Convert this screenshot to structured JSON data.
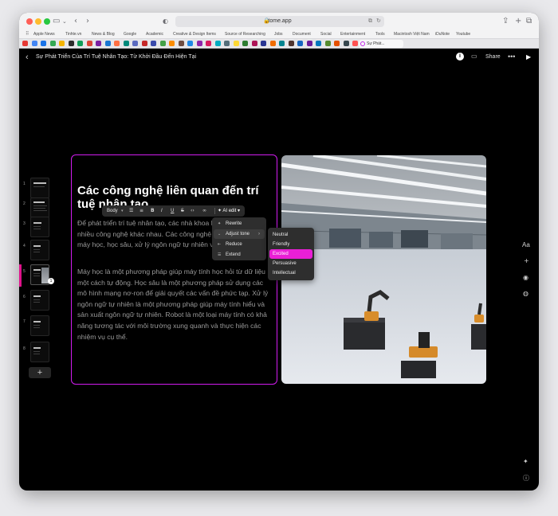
{
  "browser": {
    "url": "tome.app",
    "bookmarks": [
      "Apple News",
      "Tinhte.vn",
      "News & Blog",
      "Google",
      "Academic",
      "Creative & Design Items",
      "Source of Researching",
      "Jobs",
      "Document",
      "Social",
      "Entertainment",
      "Tools",
      "Macintosh Việt Nam",
      "iDuNote",
      "Youtube"
    ],
    "active_tab_title": "Sự Phát..."
  },
  "header": {
    "doc_title": "Sự Phát Triển Của Trí Tuệ Nhân Tạo: Từ Khởi Đầu Đến Hiện Tại",
    "info_label": "i",
    "share_label": "Share"
  },
  "thumbnails": {
    "pages": [
      "1",
      "2",
      "3",
      "4",
      "5",
      "6",
      "7",
      "8"
    ],
    "active_page": "5",
    "badge": "1"
  },
  "slide": {
    "heading": "Các công nghệ liên quan đến trí tuệ nhân tạo",
    "paragraph1": "Để phát triển trí tuệ nhân tạo, các nhà khoa học phải sử dụng nhiều công nghệ khác nhau. Các công nghệ này bao gồm: máy học, học sâu, xử lý ngôn ngữ tự nhiên và robot.",
    "paragraph2": "Máy học là một phương pháp giúp máy tính học hỏi từ dữ liệu một cách tự động. Học sâu là một phương pháp sử dụng các mô hình mạng nơ-ron để giải quyết các vấn đề phức tạp. Xử lý ngôn ngữ tự nhiên là một phương pháp giúp máy tính hiểu và sản xuất ngôn ngữ tự nhiên. Robot là một loại máy tính có khả năng tương tác với môi trường xung quanh và thực hiện các nhiệm vụ cụ thể."
  },
  "format_toolbar": {
    "text_style": "Body",
    "bold": "B",
    "italic": "I",
    "underline": "U",
    "strike": "S",
    "ai_edit_label": "AI edit"
  },
  "ai_menu": {
    "items": [
      "Rewrite",
      "Adjust tone",
      "Reduce",
      "Extend"
    ]
  },
  "tone_menu": {
    "items": [
      "Neutral",
      "Friendly",
      "Excited",
      "Persuasive",
      "Intellectual"
    ],
    "selected": "Excited"
  },
  "right_rail": {
    "aa_label": "Aa"
  },
  "colors": {
    "accent": "#d21cf0",
    "selected_tone": "#ea1fd6",
    "page_indicator": "#e0138c"
  }
}
